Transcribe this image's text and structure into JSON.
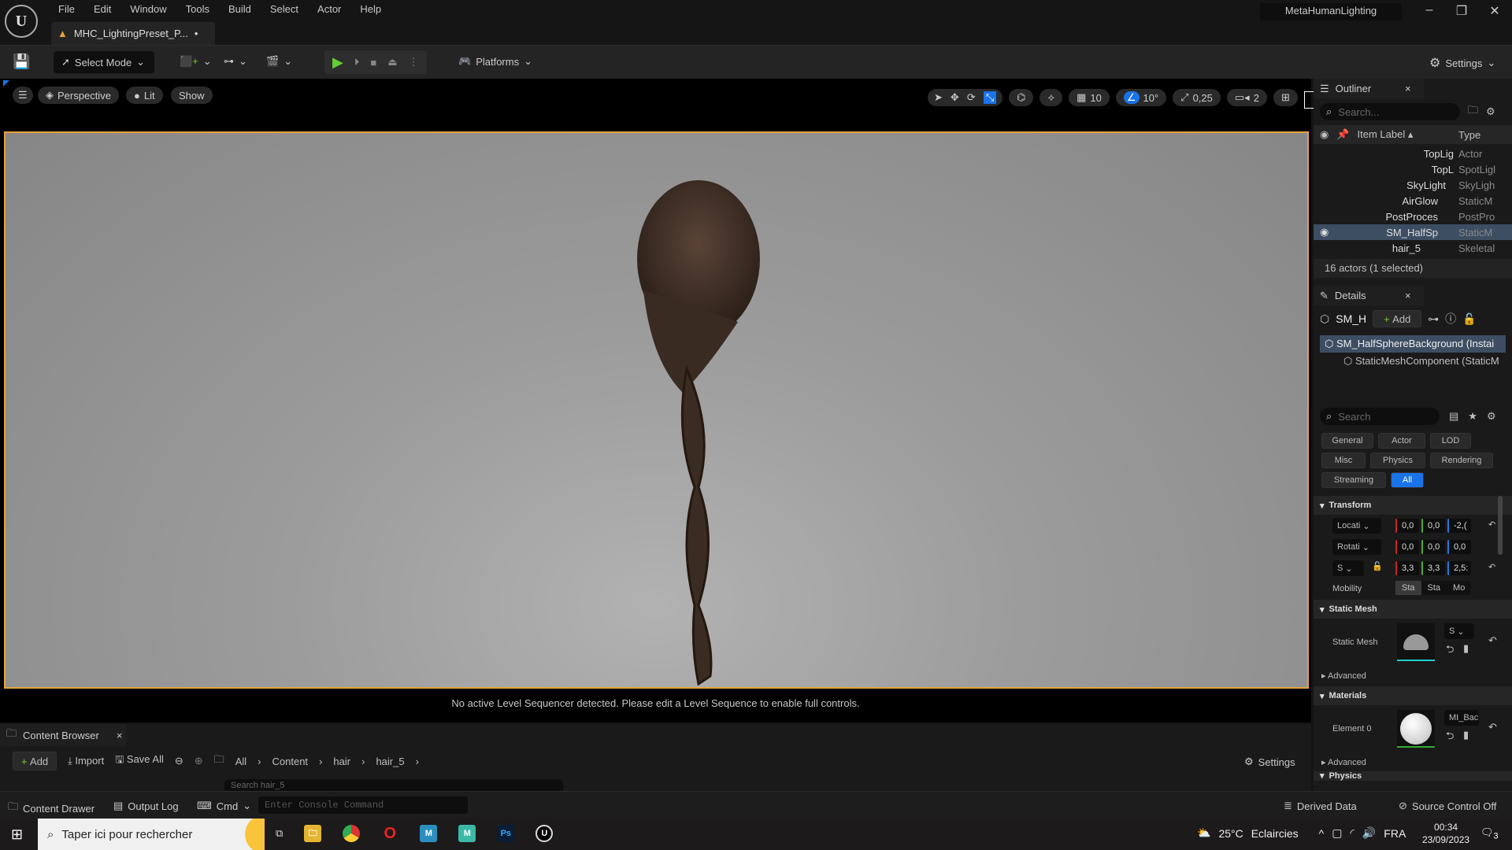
{
  "app": {
    "logo": "U",
    "menu": [
      "File",
      "Edit",
      "Window",
      "Tools",
      "Build",
      "Select",
      "Actor",
      "Help"
    ],
    "doc_tab": "MHC_LightingPreset_P...",
    "doc_tab_dirty": "•",
    "window_title": "MetaHumanLighting"
  },
  "toolbar": {
    "select_mode": "Select Mode",
    "platforms": "Platforms",
    "settings": "Settings"
  },
  "viewport": {
    "perspective": "Perspective",
    "lit": "Lit",
    "show": "Show",
    "grid_snap": "10",
    "rotation_snap": "10°",
    "scale_snap": "0,25",
    "camera_speed": "2",
    "message": "No active Level Sequencer detected. Please edit a Level Sequence to enable full controls.",
    "accent": "#e6a23c"
  },
  "outliner": {
    "tab": "Outliner",
    "search_placeholder": "Search...",
    "col_label": "Item Label",
    "col_type": "Type",
    "rows": [
      {
        "label": "TopLig",
        "type": "Actor"
      },
      {
        "label": "TopL",
        "type": "SpotLigl"
      },
      {
        "label": "SkyLight",
        "type": "SkyLigh"
      },
      {
        "label": "AirGlow",
        "type": "StaticM"
      },
      {
        "label": "PostProces",
        "type": "PostPro"
      },
      {
        "label": "SM_HalfSp",
        "type": "StaticM"
      },
      {
        "label": "hair_5",
        "type": "Skeletal"
      }
    ],
    "footer": "16 actors (1 selected)"
  },
  "details": {
    "tab": "Details",
    "actor_short": "SM_H",
    "add": "Add",
    "tree": [
      "SM_HalfSphereBackground (Instai",
      "StaticMeshComponent (StaticM"
    ],
    "search_placeholder": "Search",
    "filters": [
      "General",
      "Actor",
      "LOD",
      "Misc",
      "Physics",
      "Rendering",
      "Streaming",
      "All"
    ],
    "transform": {
      "title": "Transform",
      "location": {
        "label": "Locati",
        "x": "0,0",
        "y": "0,0",
        "z": "-2,("
      },
      "rotation": {
        "label": "Rotati",
        "x": "0,0",
        "y": "0,0",
        "z": "0,0"
      },
      "scale": {
        "label": "S",
        "x": "3,3",
        "y": "3,3",
        "z": "2,5:"
      },
      "mobility_label": "Mobility",
      "mobility": [
        "Sta",
        "Sta",
        "Mo"
      ]
    },
    "static_mesh": {
      "title": "Static Mesh",
      "label": "Static Mesh",
      "value": "S",
      "advanced": "Advanced"
    },
    "materials": {
      "title": "Materials",
      "label": "Element 0",
      "value": "MI_Bac",
      "advanced": "Advanced"
    },
    "physics": "Physics"
  },
  "content_browser": {
    "tab": "Content Browser",
    "add": "Add",
    "import": "Import",
    "save_all": "Save All",
    "breadcrumb": [
      "All",
      "Content",
      "hair",
      "hair_5"
    ],
    "settings": "Settings",
    "search_placeholder": "Search hair_5"
  },
  "status": {
    "content_drawer": "Content Drawer",
    "output_log": "Output Log",
    "cmd": "Cmd",
    "console_placeholder": "Enter Console Command",
    "derived_data": "Derived Data",
    "source_control": "Source Control Off"
  },
  "taskbar": {
    "search_placeholder": "Taper ici pour rechercher",
    "weather": "25°C",
    "weather_text": "Eclaircies",
    "lang": "FRA",
    "time": "00:34",
    "date": "23/09/2023",
    "notifications": "3"
  }
}
